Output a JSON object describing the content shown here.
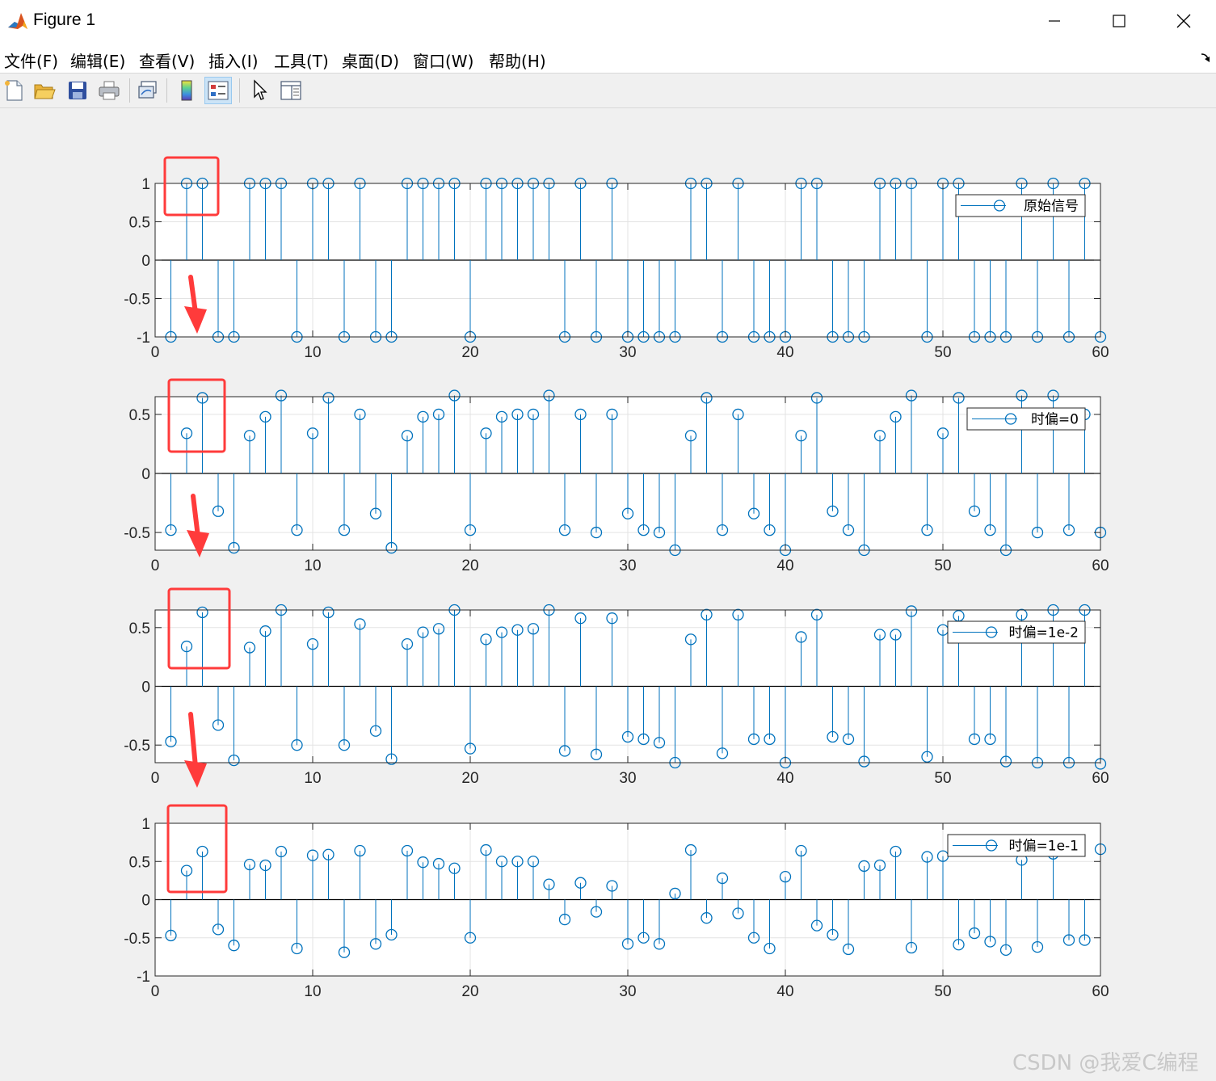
{
  "window": {
    "title": "Figure 1",
    "minimize": "—",
    "maximize": "☐",
    "close": "✕"
  },
  "menu": [
    "文件(F)",
    "编辑(E)",
    "查看(V)",
    "插入(I)",
    "工具(T)",
    "桌面(D)",
    "窗口(W)",
    "帮助(H)"
  ],
  "toolbar": {
    "icons": [
      "new-figure-icon",
      "open-file-icon",
      "save-icon",
      "print-icon",
      "link-plot-icon",
      "colorbar-icon",
      "legend-icon",
      "pointer-icon",
      "property-editor-icon"
    ]
  },
  "colors": {
    "series": "#0072bd",
    "annotation": "#ff3b3b"
  },
  "chart_data": [
    {
      "type": "stem",
      "legend": "原始信号",
      "legend_location": "northeast",
      "xlim": [
        0,
        60
      ],
      "ylim": [
        -1,
        1
      ],
      "xticks": [
        "0",
        "10",
        "20",
        "30",
        "40",
        "50",
        "60"
      ],
      "yticks": [
        "1",
        "0.5",
        "0",
        "-0.5",
        "-1"
      ],
      "grid": true,
      "x": [
        1,
        2,
        3,
        4,
        5,
        6,
        7,
        8,
        9,
        10,
        11,
        12,
        13,
        14,
        15,
        16,
        17,
        18,
        19,
        20,
        21,
        22,
        23,
        24,
        25,
        26,
        27,
        28,
        29,
        30,
        31,
        32,
        33,
        34,
        35,
        36,
        37,
        38,
        39,
        40,
        41,
        42,
        43,
        44,
        45,
        46,
        47,
        48,
        49,
        50,
        51,
        52,
        53,
        54,
        55,
        56,
        57,
        58,
        59,
        60
      ],
      "values": [
        -1,
        1,
        1,
        -1,
        -1,
        1,
        1,
        1,
        -1,
        1,
        1,
        -1,
        1,
        -1,
        -1,
        1,
        1,
        1,
        1,
        -1,
        1,
        1,
        1,
        1,
        1,
        -1,
        1,
        -1,
        1,
        -1,
        -1,
        -1,
        -1,
        1,
        1,
        -1,
        1,
        -1,
        -1,
        -1,
        1,
        1,
        -1,
        -1,
        -1,
        1,
        1,
        1,
        -1,
        1,
        1,
        -1,
        -1,
        -1,
        1,
        -1,
        1,
        -1,
        1,
        -1
      ]
    },
    {
      "type": "stem",
      "legend": "时偏=0",
      "legend_location": "northeast",
      "xlim": [
        0,
        60
      ],
      "ylim": [
        -0.65,
        0.65
      ],
      "xticks": [
        "0",
        "10",
        "20",
        "30",
        "40",
        "50",
        "60"
      ],
      "yticks": [
        "0.5",
        "0",
        "-0.5"
      ],
      "grid": true,
      "x": [
        1,
        2,
        3,
        4,
        5,
        6,
        7,
        8,
        9,
        10,
        11,
        12,
        13,
        14,
        15,
        16,
        17,
        18,
        19,
        20,
        21,
        22,
        23,
        24,
        25,
        26,
        27,
        28,
        29,
        30,
        31,
        32,
        33,
        34,
        35,
        36,
        37,
        38,
        39,
        40,
        41,
        42,
        43,
        44,
        45,
        46,
        47,
        48,
        49,
        50,
        51,
        52,
        53,
        54,
        55,
        56,
        57,
        58,
        59,
        60
      ],
      "values": [
        -0.48,
        0.34,
        0.64,
        -0.32,
        -0.63,
        0.32,
        0.48,
        0.66,
        -0.48,
        0.34,
        0.64,
        -0.48,
        0.5,
        -0.34,
        -0.63,
        0.32,
        0.48,
        0.5,
        0.66,
        -0.48,
        0.34,
        0.48,
        0.5,
        0.5,
        0.66,
        -0.48,
        0.5,
        -0.5,
        0.5,
        -0.34,
        -0.48,
        -0.5,
        -0.65,
        0.32,
        0.64,
        -0.48,
        0.5,
        -0.34,
        -0.48,
        -0.65,
        0.32,
        0.64,
        -0.32,
        -0.48,
        -0.65,
        0.32,
        0.48,
        0.66,
        -0.48,
        0.34,
        0.64,
        -0.32,
        -0.48,
        -0.65,
        0.66,
        -0.5,
        0.66,
        -0.48,
        0.5,
        -0.5
      ]
    },
    {
      "type": "stem",
      "legend": "时偏=1e-2",
      "legend_location": "northeast",
      "xlim": [
        0,
        60
      ],
      "ylim": [
        -0.65,
        0.65
      ],
      "xticks": [
        "0",
        "10",
        "20",
        "30",
        "40",
        "50",
        "60"
      ],
      "yticks": [
        "0.5",
        "0",
        "-0.5"
      ],
      "grid": true,
      "x": [
        1,
        2,
        3,
        4,
        5,
        6,
        7,
        8,
        9,
        10,
        11,
        12,
        13,
        14,
        15,
        16,
        17,
        18,
        19,
        20,
        21,
        22,
        23,
        24,
        25,
        26,
        27,
        28,
        29,
        30,
        31,
        32,
        33,
        34,
        35,
        36,
        37,
        38,
        39,
        40,
        41,
        42,
        43,
        44,
        45,
        46,
        47,
        48,
        49,
        50,
        51,
        52,
        53,
        54,
        55,
        56,
        57,
        58,
        59,
        60
      ],
      "values": [
        -0.47,
        0.34,
        0.63,
        -0.33,
        -0.63,
        0.33,
        0.47,
        0.65,
        -0.5,
        0.36,
        0.63,
        -0.5,
        0.53,
        -0.38,
        -0.62,
        0.36,
        0.46,
        0.49,
        0.65,
        -0.53,
        0.4,
        0.46,
        0.48,
        0.49,
        0.65,
        -0.55,
        0.58,
        -0.58,
        0.58,
        -0.43,
        -0.45,
        -0.48,
        -0.65,
        0.4,
        0.61,
        -0.57,
        0.61,
        -0.45,
        -0.45,
        -0.65,
        0.42,
        0.61,
        -0.43,
        -0.45,
        -0.64,
        0.44,
        0.44,
        0.64,
        -0.6,
        0.48,
        0.6,
        -0.45,
        -0.45,
        -0.64,
        0.61,
        -0.65,
        0.65,
        -0.65,
        0.65,
        -0.66
      ]
    },
    {
      "type": "stem",
      "legend": "时偏=1e-1",
      "legend_location": "northeast",
      "xlim": [
        0,
        60
      ],
      "ylim": [
        -1,
        1
      ],
      "xticks": [
        "0",
        "10",
        "20",
        "30",
        "40",
        "50",
        "60"
      ],
      "yticks": [
        "1",
        "0.5",
        "0",
        "-0.5",
        "-1"
      ],
      "grid": true,
      "x": [
        1,
        2,
        3,
        4,
        5,
        6,
        7,
        8,
        9,
        10,
        11,
        12,
        13,
        14,
        15,
        16,
        17,
        18,
        19,
        20,
        21,
        22,
        23,
        24,
        25,
        26,
        27,
        28,
        29,
        30,
        31,
        32,
        33,
        34,
        35,
        36,
        37,
        38,
        39,
        40,
        41,
        42,
        43,
        44,
        45,
        46,
        47,
        48,
        49,
        50,
        51,
        52,
        53,
        54,
        55,
        56,
        57,
        58,
        59,
        60
      ],
      "values": [
        -0.47,
        0.38,
        0.63,
        -0.39,
        -0.6,
        0.46,
        0.45,
        0.63,
        -0.64,
        0.58,
        0.59,
        -0.69,
        0.64,
        -0.58,
        -0.46,
        0.64,
        0.49,
        0.47,
        0.41,
        -0.5,
        0.65,
        0.5,
        0.5,
        0.5,
        0.2,
        -0.26,
        0.22,
        -0.16,
        0.18,
        -0.58,
        -0.5,
        -0.58,
        0.08,
        0.65,
        -0.24,
        0.28,
        -0.18,
        -0.5,
        -0.64,
        0.3,
        0.64,
        -0.34,
        -0.46,
        -0.65,
        0.44,
        0.45,
        0.63,
        -0.63,
        0.56,
        0.57,
        -0.59,
        -0.44,
        -0.55,
        -0.66,
        0.52,
        -0.62,
        0.6,
        -0.53,
        -0.53,
        0.66
      ]
    }
  ],
  "watermark": "CSDN @我爱C编程"
}
